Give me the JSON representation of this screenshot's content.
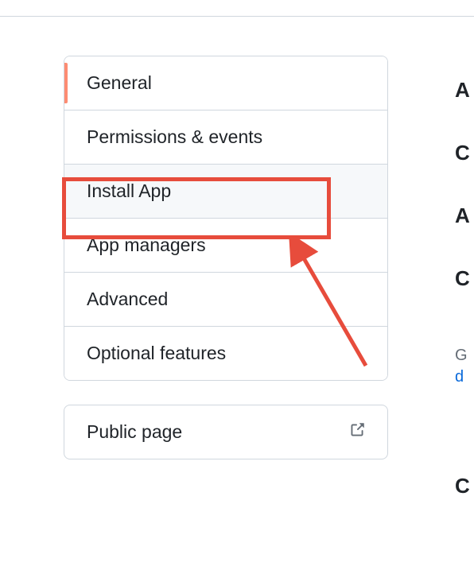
{
  "sidebar": {
    "items": [
      {
        "label": "General"
      },
      {
        "label": "Permissions & events"
      },
      {
        "label": "Install App"
      },
      {
        "label": "App managers"
      },
      {
        "label": "Advanced"
      },
      {
        "label": "Optional features"
      }
    ],
    "publicPage": "Public page"
  },
  "rightEdge": {
    "c0": "A",
    "c1": "C",
    "c2": "A",
    "c3": "C",
    "c4": "G",
    "c5": "d",
    "c6": "C"
  }
}
